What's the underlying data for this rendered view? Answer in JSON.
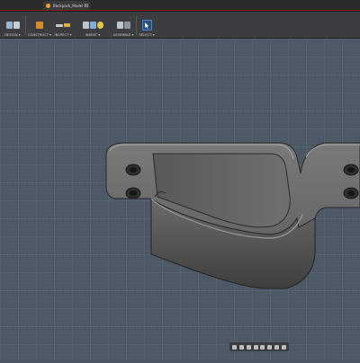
{
  "document": {
    "tab_title": "Backpack_Model v2",
    "tab_close": "×"
  },
  "toolbar": {
    "groups": [
      {
        "label": "DESIGN ▾"
      },
      {
        "label": "CONSTRUCT ▾"
      },
      {
        "label": "INSPECT ▾"
      },
      {
        "label": "INSERT ▾"
      },
      {
        "label": "ASSEMBLE ▾"
      },
      {
        "label": "SELECT ▾"
      }
    ]
  },
  "colors": {
    "grid_background": "#4a5663",
    "grid_minor": "#55616e",
    "grid_major": "#6a7684",
    "model_face": "#5e5e5e",
    "model_edge": "#2a2a2a",
    "select_accent": "#4b88c0"
  },
  "nav_icons": [
    "orbit-icon",
    "look-at-icon",
    "pan-icon",
    "zoom-icon",
    "fit-icon",
    "display-settings-icon",
    "grid-settings-icon",
    "viewports-icon"
  ]
}
